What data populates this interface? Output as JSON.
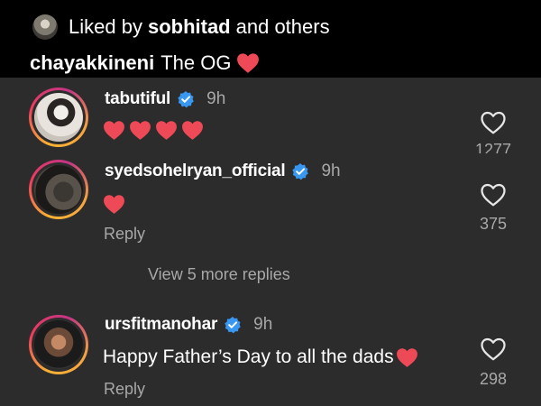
{
  "header": {
    "liked_prefix": "Liked by",
    "liked_user": "sobhitad",
    "liked_suffix": "and others",
    "caption_user": "chayakkineni",
    "caption_text": "The OG",
    "caption_icon": "red-heart-emoji"
  },
  "comments": [
    {
      "username": "tabutiful",
      "verified": true,
      "time": "9h",
      "text_icons": [
        "red-heart-emoji",
        "red-heart-emoji",
        "red-heart-emoji",
        "red-heart-emoji"
      ],
      "like_count": "1277"
    },
    {
      "username": "syedsohelryan_official",
      "verified": true,
      "time": "9h",
      "text_icons": [
        "red-heart-emoji"
      ],
      "reply_label": "Reply",
      "like_count": "375"
    },
    {
      "username": "ursfitmanohar",
      "verified": true,
      "time": "9h",
      "text": "Happy Father’s Day to all the dads",
      "text_icons": [
        "red-heart-emoji"
      ],
      "reply_label": "Reply",
      "like_count": "298"
    }
  ],
  "view_more_replies": "View 5 more replies",
  "colors": {
    "header_bg": "#000000",
    "panel_bg": "#2c2c2c",
    "heart": "#ed4956",
    "verified": "#3897f0",
    "secondary_text": "#a8a8a8"
  }
}
